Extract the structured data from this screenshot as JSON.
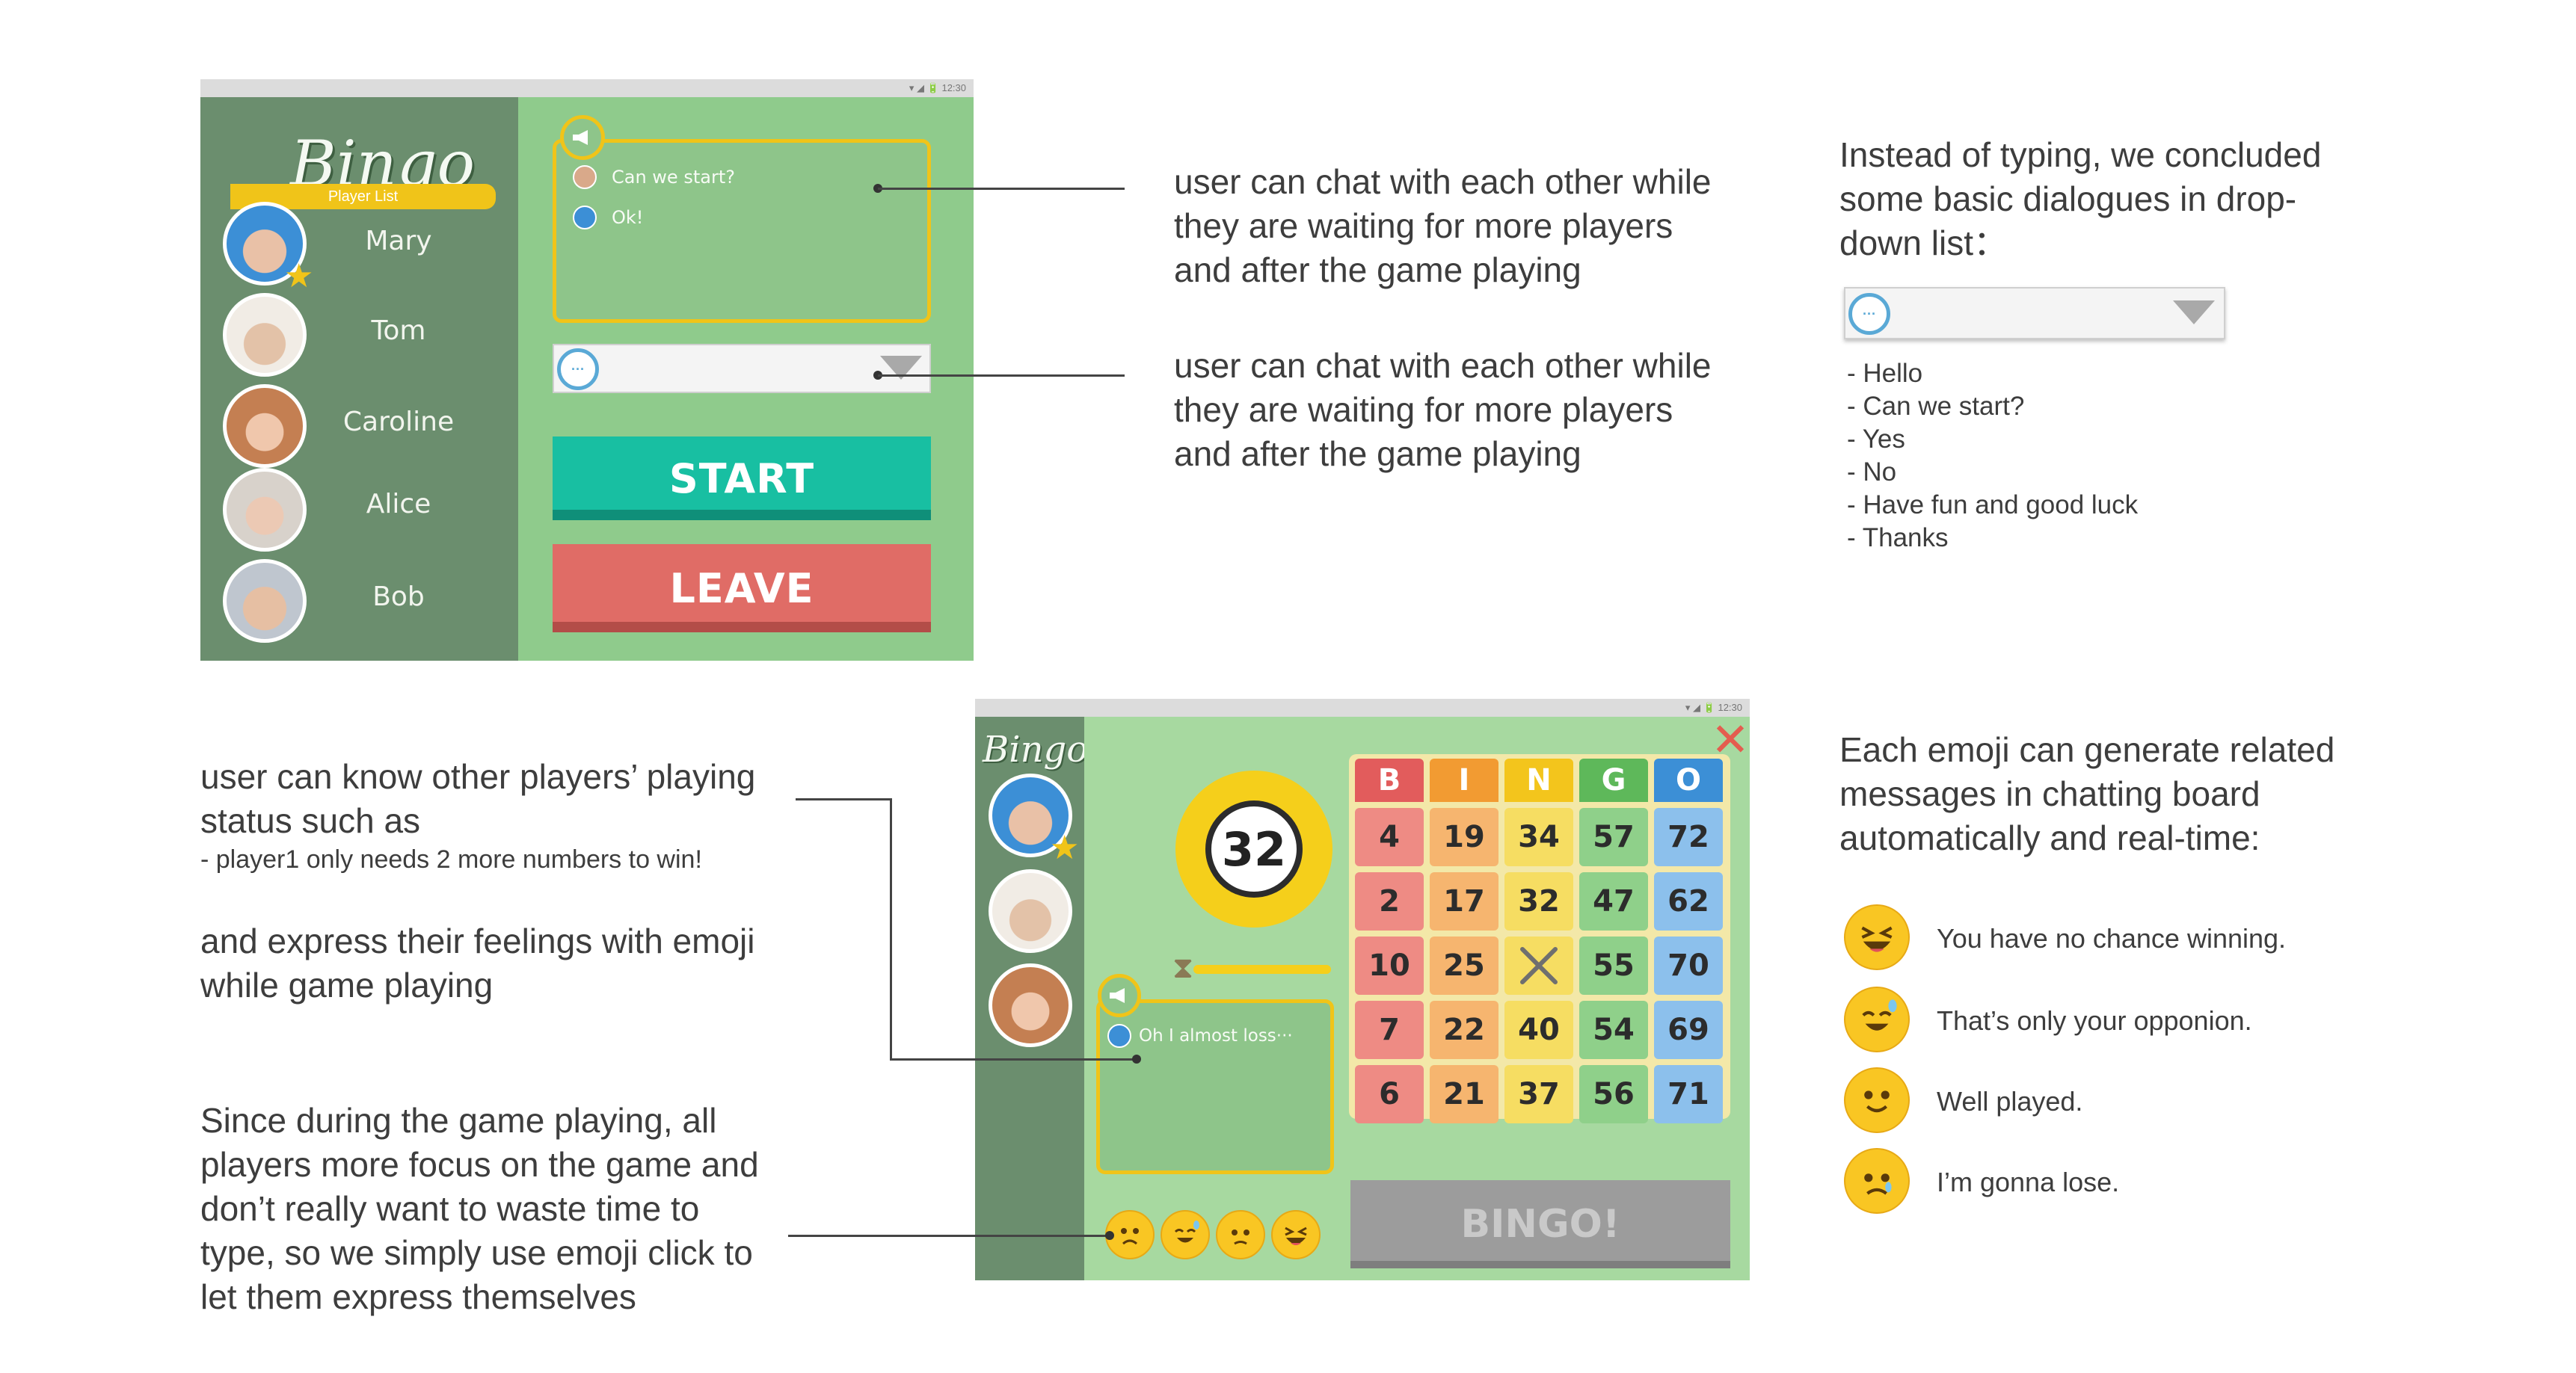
{
  "lobby": {
    "status_time": "▾ ◢ 🔋 12:30",
    "logo": "Bingo",
    "player_list_label": "Player  List",
    "players": [
      {
        "name": "Mary",
        "star": true,
        "avatar_color": "#3c8fd6"
      },
      {
        "name": "Tom",
        "star": false,
        "avatar_color": "#b8a79b"
      },
      {
        "name": "Caroline",
        "star": false,
        "avatar_color": "#c88a63"
      },
      {
        "name": "Alice",
        "star": false,
        "avatar_color": "#d8b6a3"
      },
      {
        "name": "Bob",
        "star": false,
        "avatar_color": "#cfa88e"
      }
    ],
    "chat": [
      "Can we start?",
      "Ok!"
    ],
    "dropdown_icon": "speech-bubble-icon",
    "start_label": "START",
    "leave_label": "LEAVE",
    "colors": {
      "start": "#18bfa2",
      "leave": "#e06c66",
      "accent": "#f0c419"
    }
  },
  "notes": {
    "chat_note_1": [
      "user can chat with each other while",
      "they are waiting for more players",
      "and after the game playing"
    ],
    "chat_note_2": [
      "user can chat with each other while",
      "they are waiting for more players",
      "and after the game playing"
    ],
    "dropdown_intro": [
      "Instead of typing, we concluded",
      "some basic dialogues in drop-",
      "down list："
    ],
    "dropdown_options": [
      "- Hello",
      "- Can we start?",
      "- Yes",
      "- No",
      "- Have fun and good luck",
      "- Thanks"
    ],
    "status_note": [
      "user can know other players’ playing",
      "status such as"
    ],
    "status_example": "- player1 only needs 2 more numbers to win!",
    "emoji_note": [
      "and express their feelings with emoji",
      "while  game playing"
    ],
    "focus_note": [
      "Since during the game playing, all",
      "players more focus on the game and",
      "don’t really want to waste time to",
      "type, so we simply use emoji click to",
      "let them express themselves"
    ],
    "emoji_intro": [
      "Each emoji can generate related",
      "messages in chatting board",
      "automatically and real-time:"
    ],
    "emoji_messages": [
      {
        "icon": "laughing-emoji-icon",
        "text": "You have no chance winning."
      },
      {
        "icon": "sweat-smile-emoji-icon",
        "text": "That’s only your opponion."
      },
      {
        "icon": "smile-emoji-icon",
        "text": "Well played."
      },
      {
        "icon": "sad-emoji-icon",
        "text": "I’m gonna lose."
      }
    ]
  },
  "game": {
    "status_time": "▾ ◢ 🔋 12:30",
    "logo": "Bingo",
    "called_number": "32",
    "chat_message": "Oh I almost loss···",
    "bingo_label": "BINGO!",
    "close_icon": "close-x-icon",
    "card": {
      "headers": [
        "B",
        "I",
        "N",
        "G",
        "O"
      ],
      "header_colors": [
        "#e25c5c",
        "#f29b32",
        "#f3c51c",
        "#5eb85a",
        "#3c8fd6"
      ],
      "cell_colors": [
        "#ee8b84",
        "#f6b56f",
        "#f6dd62",
        "#8fd08a",
        "#8cc0ec"
      ],
      "rows": [
        [
          "4",
          "19",
          "34",
          "57",
          "72"
        ],
        [
          "2",
          "17",
          "32",
          "47",
          "62"
        ],
        [
          "10",
          "25",
          "X",
          "55",
          "70"
        ],
        [
          "7",
          "22",
          "40",
          "54",
          "69"
        ],
        [
          "6",
          "21",
          "37",
          "56",
          "71"
        ]
      ]
    },
    "emoji_bar": [
      "sad-emoji-icon",
      "sweat-smile-emoji-icon",
      "worried-emoji-icon",
      "laughing-emoji-icon"
    ]
  }
}
